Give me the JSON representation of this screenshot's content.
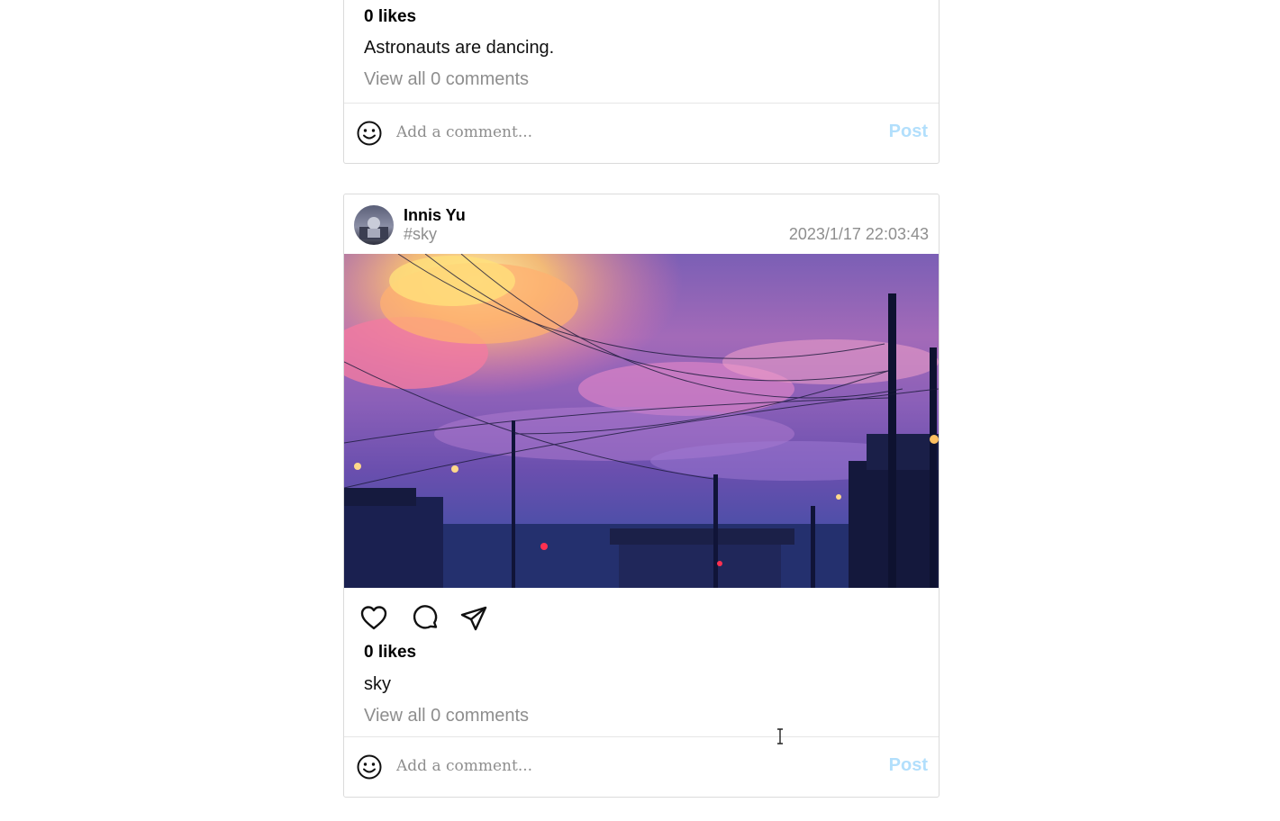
{
  "previous_post": {
    "likes": "0 likes",
    "caption": "Astronauts are dancing.",
    "view_comments": "View all 0 comments",
    "comment_placeholder": "Add a comment...",
    "post_label": "Post"
  },
  "post": {
    "username": "Innis Yu",
    "tag": "#sky",
    "timestamp": "2023/1/17 22:03:43",
    "likes": "0 likes",
    "caption": "sky",
    "view_comments": "View all 0 comments",
    "comment_placeholder": "Add a comment...",
    "post_label": "Post",
    "actions": [
      "heart-icon",
      "comment-icon",
      "share-icon"
    ]
  },
  "colors": {
    "post_button": "#b2dffc",
    "muted_text": "#8e8e8e",
    "border": "#dbdbdb"
  }
}
